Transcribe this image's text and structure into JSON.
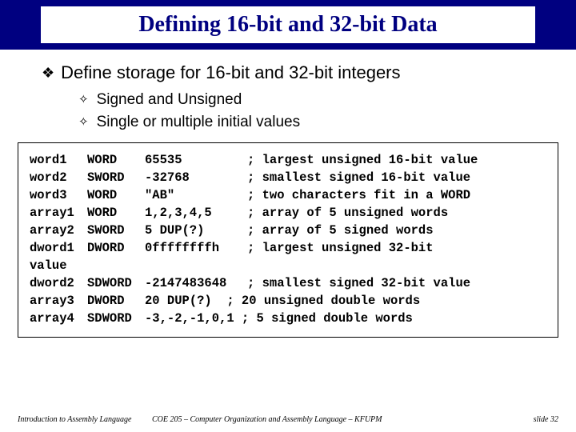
{
  "title": "Defining 16-bit and 32-bit Data",
  "bullets": {
    "l1": "Define storage for 16-bit and 32-bit integers",
    "l2a": "Signed and Unsigned",
    "l2b": "Single or multiple initial values"
  },
  "code": [
    {
      "label": "word1",
      "type": "WORD",
      "val": "65535",
      "cmt": "; largest unsigned 16-bit value"
    },
    {
      "label": "word2",
      "type": "SWORD",
      "val": "-32768",
      "cmt": "; smallest signed 16-bit value"
    },
    {
      "label": "word3",
      "type": "WORD",
      "val": "\"AB\"",
      "cmt": "; two characters fit in a WORD"
    },
    {
      "label": "array1",
      "type": "WORD",
      "val": "1,2,3,4,5",
      "cmt": "; array of 5 unsigned words"
    },
    {
      "label": "array2",
      "type": "SWORD",
      "val": "5 DUP(?)",
      "cmt": "; array of 5 signed words"
    },
    {
      "label": "dword1",
      "type": "DWORD",
      "val": "0ffffffffh",
      "cmt": "; largest unsigned 32-bit"
    },
    {
      "label": "value",
      "type": "",
      "val": "",
      "cmt": ""
    },
    {
      "label": "dword2",
      "type": "SDWORD",
      "val": "-2147483648",
      "cmt": "; smallest signed 32-bit value"
    }
  ],
  "code_special": [
    {
      "label": "array3",
      "type": "DWORD",
      "rest": "20 DUP(?)  ; 20 unsigned double words"
    },
    {
      "label": "array4",
      "type": "SDWORD",
      "rest": "-3,-2,-1,0,1 ; 5 signed double words"
    }
  ],
  "footer": {
    "left": "Introduction to Assembly Language",
    "center": "COE 205 – Computer Organization and Assembly Language – KFUPM",
    "right": "slide 32"
  },
  "markers": {
    "diamond_filled": "❖",
    "diamond_open": "✧"
  }
}
